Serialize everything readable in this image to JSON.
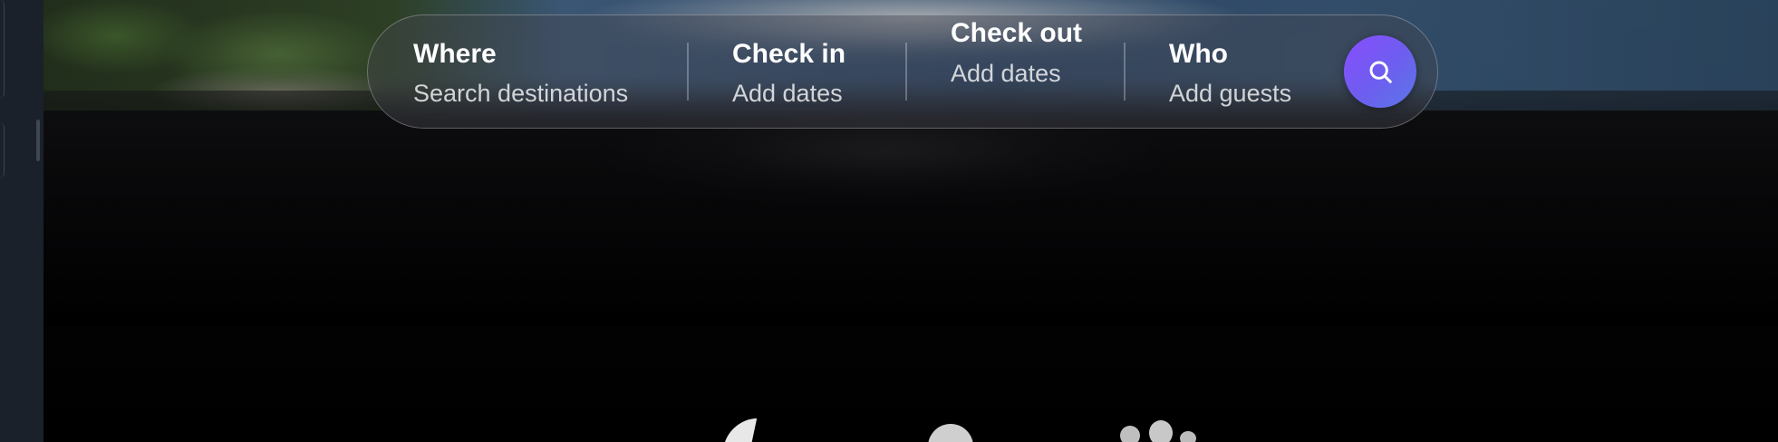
{
  "search": {
    "where": {
      "label": "Where",
      "placeholder": "Search destinations"
    },
    "check_in": {
      "label": "Check in",
      "placeholder": "Add dates"
    },
    "check_out": {
      "label": "Check out",
      "placeholder": "Add dates"
    },
    "who": {
      "label": "Who",
      "placeholder": "Add guests"
    },
    "button_icon": "search-icon"
  },
  "colors": {
    "search_button_start": "#8a4dff",
    "search_button_end": "#5a77e8",
    "background": "#000000",
    "rail": "#1b212b"
  }
}
